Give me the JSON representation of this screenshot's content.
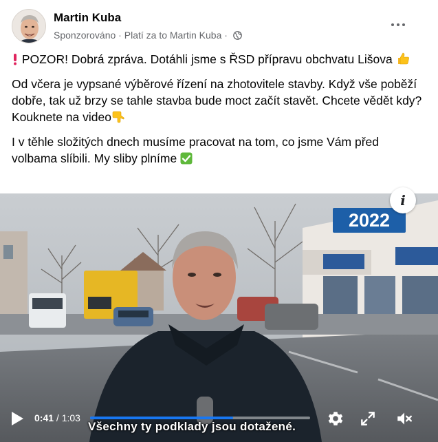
{
  "post": {
    "author": "Martin Kuba",
    "sponsored": "Sponzorováno",
    "separator": " · ",
    "paid_by": "Platí za to Martin Kuba",
    "privacy_icon": "globe-icon",
    "more_icon": "more-horizontal-icon"
  },
  "text": {
    "p1": "POZOR! Dobrá zpráva. Dotáhli jsme s ŘSD přípravu obchvatu Lišova",
    "p2": "Od včera je vypsané výběrové řízení na zhotovitele stavby. Když vše poběží dobře, tak už brzy se tahle stavba bude moct začít stavět. Chcete vědět kdy? Kouknete na video",
    "p3": "I v těhle složitých dnech musíme pracovat na tom, co jsme Vám před volbama slíbili. My sliby plníme",
    "emoji_exclamation": "exclamation-emoji",
    "emoji_thumbs_up": "thumbs-up-emoji",
    "emoji_point_down": "point-down-emoji",
    "emoji_check": "check-mark-emoji"
  },
  "video": {
    "year_badge": "2022",
    "info_icon": "i",
    "current_time": "0:41",
    "time_separator": " / ",
    "duration": "1:03",
    "progress_fraction": 0.65,
    "subtitle": "Všechny ty podklady jsou dotažené.",
    "accent_color": "#1877f2",
    "badge_color": "#1d5fa8"
  }
}
